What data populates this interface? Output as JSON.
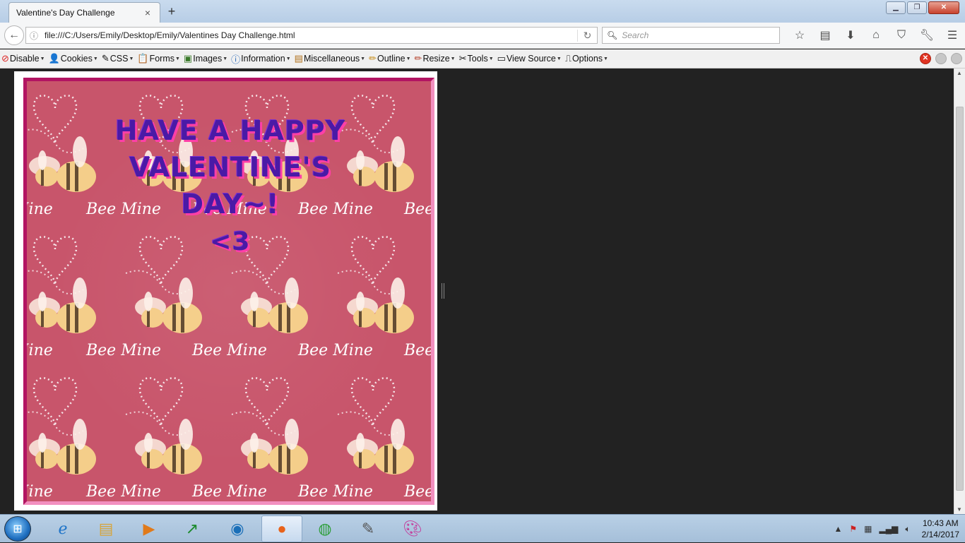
{
  "window": {
    "tab_title": "Valentine's Day Challenge",
    "new_tab": "+",
    "close_tab": "×",
    "controls": {
      "minimize": "▁",
      "maximize": "❐",
      "close": "✕"
    }
  },
  "navbar": {
    "url": "file:///C:/Users/Emily/Desktop/Emily/Valentines Day Challenge.html",
    "search_placeholder": "Search",
    "icons": [
      "bookmark-star-icon",
      "reading-list-icon",
      "download-icon",
      "home-icon",
      "pocket-icon",
      "wrench-icon",
      "menu-icon"
    ]
  },
  "devbar": {
    "items": [
      {
        "label": "Disable",
        "icon": "⊘"
      },
      {
        "label": "Cookies",
        "icon": "👤"
      },
      {
        "label": "CSS",
        "icon": "✎"
      },
      {
        "label": "Forms",
        "icon": "📋"
      },
      {
        "label": "Images",
        "icon": "▣"
      },
      {
        "label": "Information",
        "icon": "ⓘ"
      },
      {
        "label": "Miscellaneous",
        "icon": "▤"
      },
      {
        "label": "Outline",
        "icon": "✏"
      },
      {
        "label": "Resize",
        "icon": "✏"
      },
      {
        "label": "Tools",
        "icon": "✂"
      },
      {
        "label": "View Source",
        "icon": "▭"
      },
      {
        "label": "Options",
        "icon": "⎍"
      }
    ]
  },
  "page": {
    "headline": {
      "line1": "HAVE A HAPPY",
      "line2": "VALENTINE'S",
      "line3": "DAY~!",
      "line4": "<3"
    },
    "pattern_text": "Bee Mine",
    "colors": {
      "background": "#c8556b",
      "border_dark": "#b21462",
      "border_light": "#f28fbf",
      "text": "#4a1aa6",
      "text_shadow": "#ff3fa8"
    }
  },
  "taskbar": {
    "apps": [
      "internet-explorer-icon",
      "file-explorer-icon",
      "media-player-icon",
      "stock-app-icon",
      "network-icon",
      "firefox-icon",
      "chrome-icon",
      "notepad-icon",
      "paint-icon"
    ],
    "clock_time": "10:43 AM",
    "clock_date": "2/14/2017"
  }
}
